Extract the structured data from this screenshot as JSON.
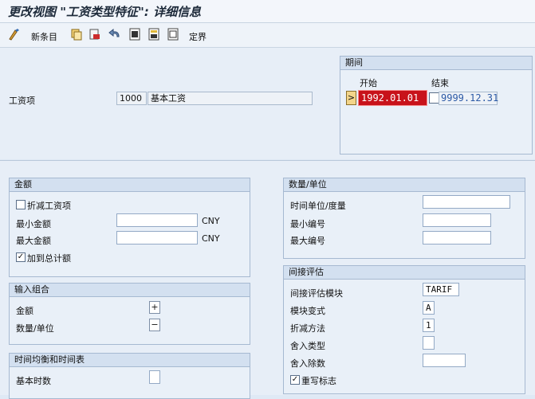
{
  "title": "更改视图 \"工资类型特征\": 详细信息",
  "toolbar": {
    "new_entry_label": "新条目",
    "delimit_label": "定界",
    "icons": [
      "display-change-icon",
      "copy-icon",
      "delete-icon",
      "undo-icon",
      "select-all-icon",
      "select-block-icon",
      "deselect-icon"
    ]
  },
  "wage_type": {
    "label": "工资项",
    "code": "1000",
    "description": "基本工资"
  },
  "period": {
    "title": "期间",
    "start_label": "开始",
    "end_label": "结束",
    "start_value": "1992.01.01",
    "end_value": "9999.12.31",
    "start_prefix": ">"
  },
  "amount": {
    "title": "金额",
    "reduce_wage_label": "折减工资项",
    "reduce_wage_checked": false,
    "min_label": "最小金额",
    "min_value": "",
    "min_currency": "CNY",
    "max_label": "最大金额",
    "max_value": "",
    "max_currency": "CNY",
    "add_to_total_label": "加到总计额",
    "add_to_total_checked": true
  },
  "input_combo": {
    "title": "输入组合",
    "amount_label": "金额",
    "amount_value": "+",
    "qty_label": "数量/单位",
    "qty_value": "−"
  },
  "time_balance": {
    "title": "时间均衡和时间表",
    "base_hours_label": "基本时数",
    "base_hours_value": ""
  },
  "quantity": {
    "title": "数量/单位",
    "time_unit_label": "时间单位/度量",
    "time_unit_value": "",
    "min_no_label": "最小编号",
    "min_no_value": "",
    "max_no_label": "最大编号",
    "max_no_value": ""
  },
  "indirect": {
    "title": "间接评估",
    "module_label": "间接评估模块",
    "module_value": "TARIF",
    "variant_label": "模块变式",
    "variant_value": "A",
    "reduction_label": "折减方法",
    "reduction_value": "1",
    "rounding_type_label": "舍入类型",
    "rounding_type_value": "",
    "rounding_div_label": "舍入除数",
    "rounding_div_value": "",
    "overwrite_label": "重写标志",
    "overwrite_checked": true
  }
}
